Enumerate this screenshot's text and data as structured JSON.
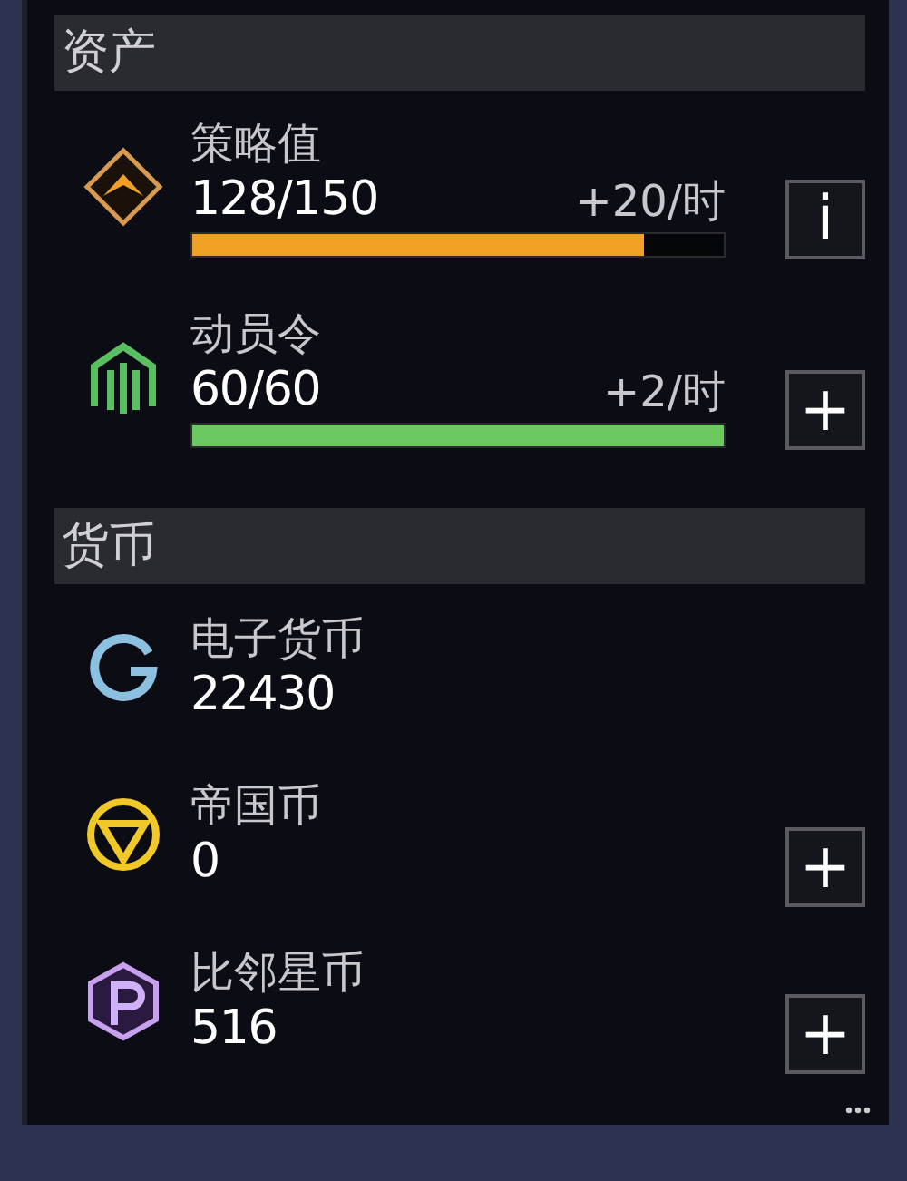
{
  "sections": [
    {
      "title": "资产",
      "kind": "assets",
      "items": [
        {
          "name": "策略值",
          "value": "128/150",
          "rate": "+20/时",
          "level": 0.85,
          "color": "#f0a024",
          "kind": "diamond",
          "button": "i"
        },
        {
          "name": "动员令",
          "value": "60/60",
          "rate": "+2/时",
          "level": 1.0,
          "color": "#6cc860",
          "kind": "pillars",
          "button": "+"
        }
      ]
    },
    {
      "title": "货币",
      "kind": "currencies",
      "items": [
        {
          "name": "电子货币",
          "value": "22430",
          "kind": "ring"
        },
        {
          "name": "帝国币",
          "value": "0",
          "kind": "triangle",
          "button": "+"
        },
        {
          "name": "比邻星币",
          "value": "516",
          "kind": "hex",
          "button": "+"
        }
      ]
    }
  ]
}
